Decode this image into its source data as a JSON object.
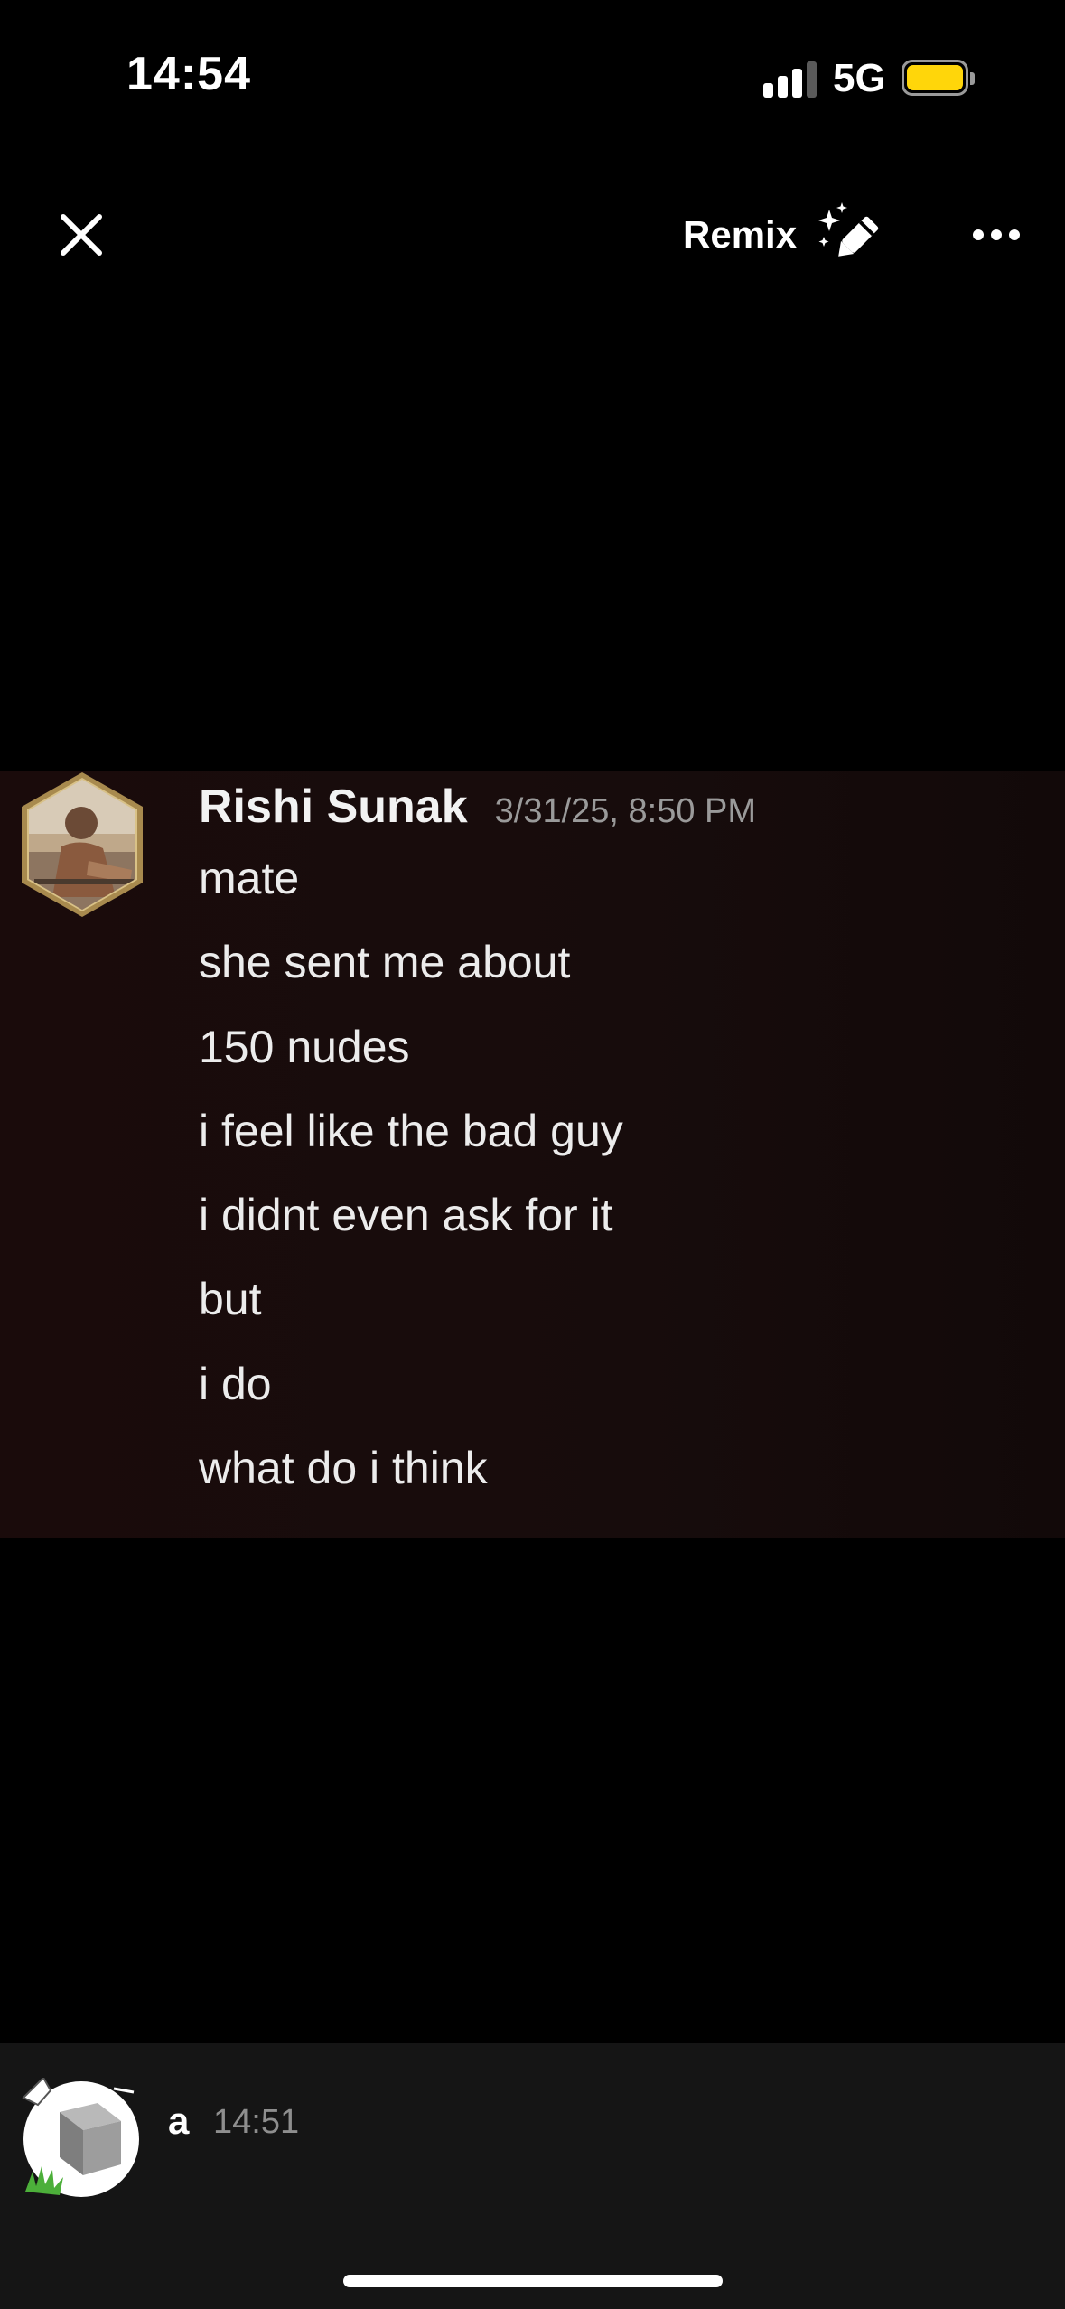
{
  "status_bar": {
    "time": "14:54",
    "network": "5G",
    "signal_bars": 3,
    "battery_level": 1.0,
    "battery_color": "#ffd60a"
  },
  "top_nav": {
    "close_icon": "close-icon",
    "remix_label": "Remix",
    "remix_icon": "magic-pencil-icon",
    "more_icon": "more-dots-icon"
  },
  "message": {
    "author": "Rishi Sunak",
    "timestamp": "3/31/25, 8:50 PM",
    "lines": [
      "mate",
      "she sent me about",
      "150 nudes",
      "i feel like the bad guy",
      "i didnt even ask for it",
      "but",
      "i do",
      "what do i think"
    ]
  },
  "footer": {
    "username": "a",
    "time": "14:51"
  }
}
